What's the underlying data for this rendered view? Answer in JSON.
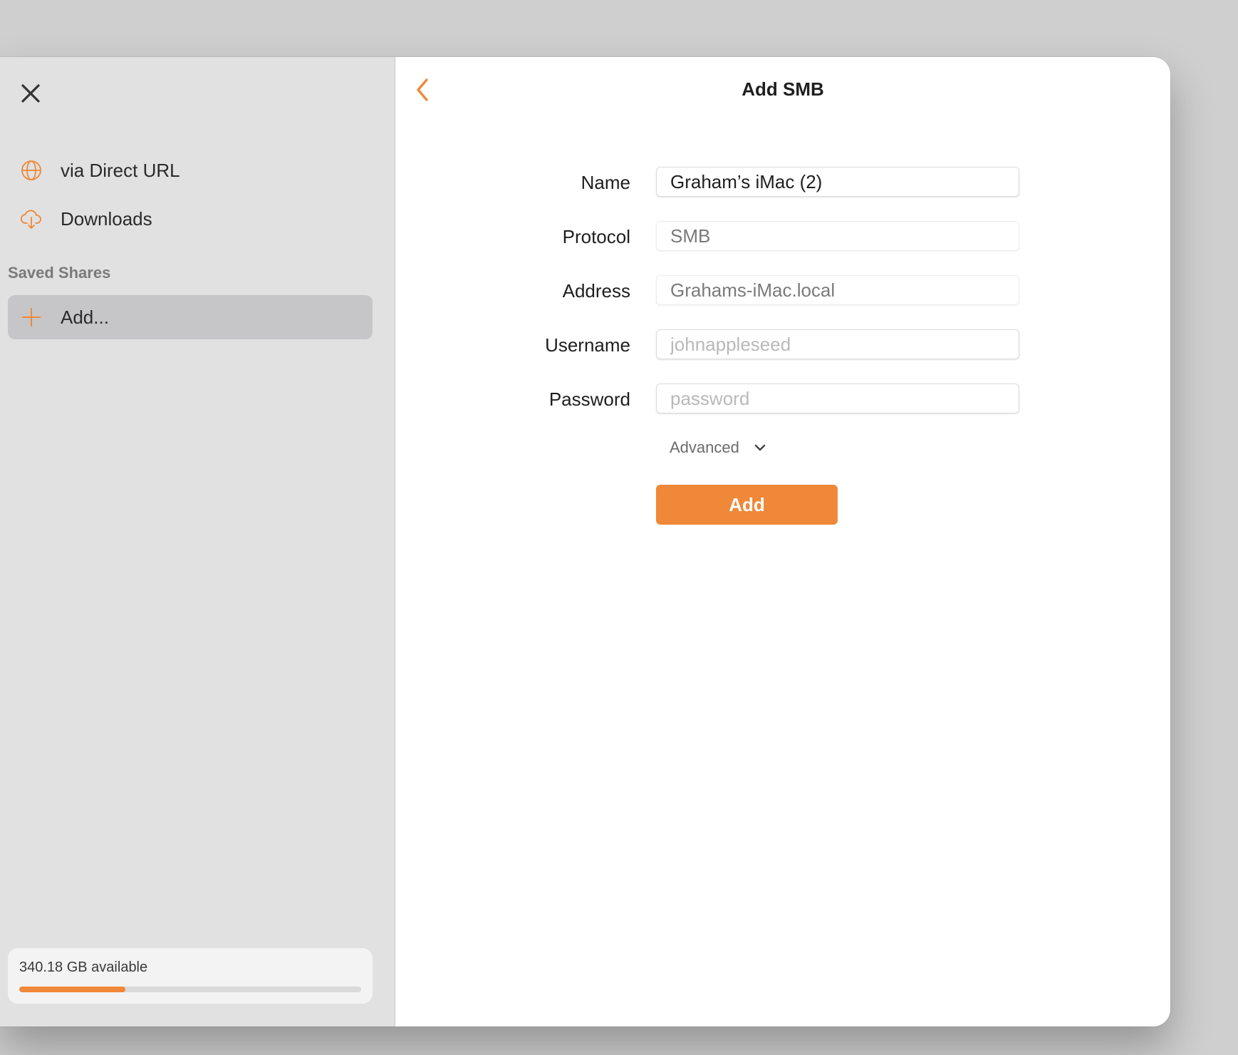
{
  "sidebar": {
    "items": [
      {
        "label": "via Direct URL",
        "icon": "globe-icon"
      },
      {
        "label": "Downloads",
        "icon": "cloud-download-icon"
      }
    ],
    "section_title": "Saved Shares",
    "add_item": {
      "label": "Add...",
      "icon": "plus-icon"
    },
    "storage": {
      "text": "340.18 GB available",
      "used_fraction": 0.31
    }
  },
  "main": {
    "title": "Add SMB",
    "form": {
      "name": {
        "label": "Name",
        "value": "Graham’s iMac (2)"
      },
      "protocol": {
        "label": "Protocol",
        "value": "SMB"
      },
      "address": {
        "label": "Address",
        "value": "Grahams-iMac.local"
      },
      "username": {
        "label": "Username",
        "placeholder": "johnappleseed"
      },
      "password": {
        "label": "Password",
        "placeholder": "password"
      }
    },
    "advanced_label": "Advanced",
    "add_button_label": "Add"
  },
  "colors": {
    "accent": "#ef8838",
    "sidebar_bg": "#e1e1e1",
    "selected_bg": "#c6c6c8"
  }
}
